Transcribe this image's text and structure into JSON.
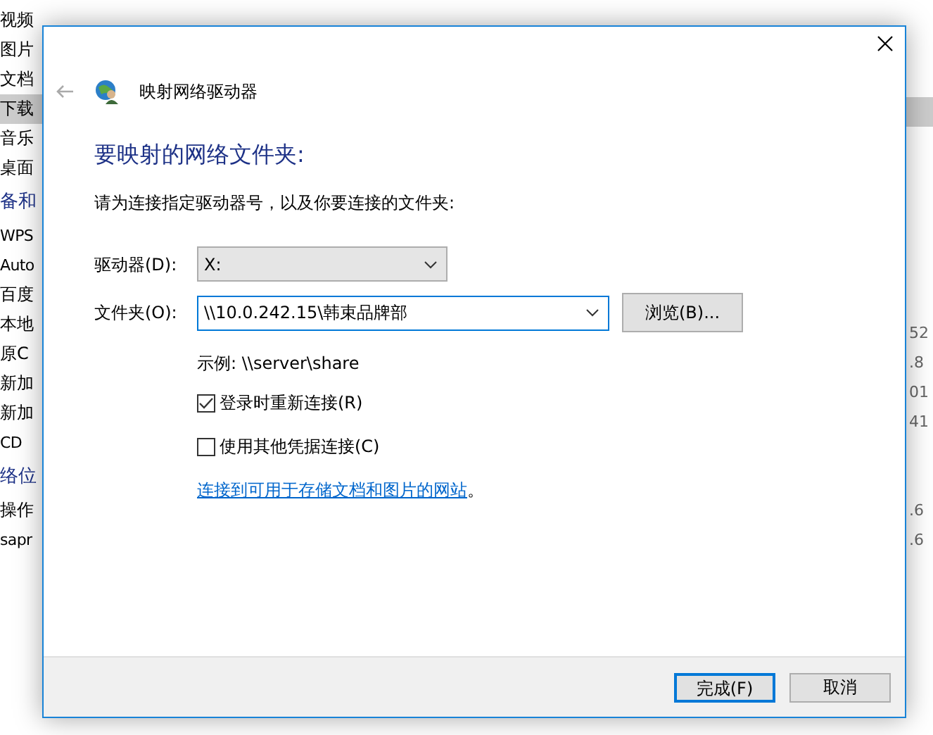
{
  "background_window": {
    "nav_items": [
      {
        "label": "视频",
        "kind": "item",
        "selected": false
      },
      {
        "label": "图片",
        "kind": "item",
        "selected": false
      },
      {
        "label": "文档",
        "kind": "item",
        "selected": false
      },
      {
        "label": "下载",
        "kind": "item",
        "selected": true
      },
      {
        "label": "音乐",
        "kind": "item",
        "selected": false
      },
      {
        "label": "桌面",
        "kind": "item",
        "selected": false
      },
      {
        "label": "备和",
        "kind": "group",
        "selected": false
      },
      {
        "label": "WPS",
        "kind": "item",
        "selected": false
      },
      {
        "label": "Auto",
        "kind": "item",
        "selected": false
      },
      {
        "label": "百度",
        "kind": "item",
        "selected": false
      },
      {
        "label": "本地",
        "kind": "item",
        "selected": false
      },
      {
        "label": "原C",
        "kind": "item",
        "selected": false
      },
      {
        "label": "新加",
        "kind": "item",
        "selected": false
      },
      {
        "label": "新加",
        "kind": "item",
        "selected": false
      },
      {
        "label": "CD",
        "kind": "item",
        "selected": false
      },
      {
        "label": "络位",
        "kind": "group",
        "selected": false
      },
      {
        "label": "操作",
        "kind": "item",
        "selected": false
      },
      {
        "label": "sapr",
        "kind": "item",
        "selected": false
      }
    ],
    "sizes": [
      "52",
      ".8",
      "01",
      "41",
      ".6",
      ".6"
    ]
  },
  "dialog": {
    "title": "映射网络驱动器",
    "heading": "要映射的网络文件夹:",
    "instruction": "请为连接指定驱动器号，以及你要连接的文件夹:",
    "drive": {
      "label": "驱动器(D):",
      "value": "X:"
    },
    "folder": {
      "label": "文件夹(O):",
      "value": "\\\\10.0.242.15\\韩束品牌部",
      "focused": true
    },
    "browse_button": "浏览(B)...",
    "example": "示例: \\\\server\\share",
    "options": [
      {
        "label": "登录时重新连接(R)",
        "checked": true
      },
      {
        "label": "使用其他凭据连接(C)",
        "checked": false
      }
    ],
    "link": "连接到可用于存储文档和图片的网站",
    "link_suffix": "。",
    "buttons": [
      {
        "label": "完成(F)",
        "default": true
      },
      {
        "label": "取消",
        "default": false
      }
    ]
  }
}
